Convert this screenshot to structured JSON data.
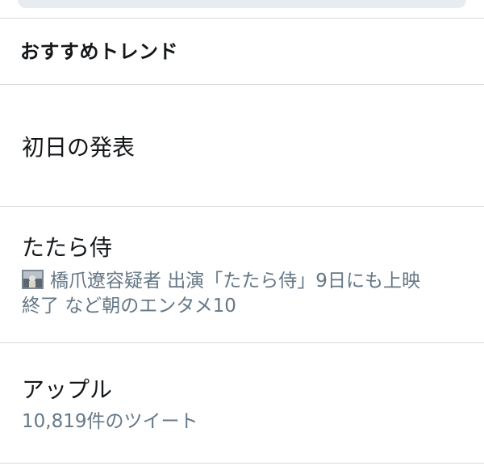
{
  "section": {
    "header": "おすすめトレンド"
  },
  "trends": [
    {
      "title": "初日の発表"
    },
    {
      "title": "たたら侍",
      "news_line1": "橋爪遼容疑者 出演「たたら侍」9日にも上映",
      "news_line2": "終了 など朝のエンタメ10",
      "thumb_icon": "news-thumbnail-image"
    },
    {
      "title": "アップル",
      "tweet_count": "10,819件のツイート"
    }
  ],
  "colors": {
    "text_primary": "#14171a",
    "text_secondary": "#657786",
    "divider": "#d9d9d9",
    "search_bg": "#e6ecf0"
  }
}
